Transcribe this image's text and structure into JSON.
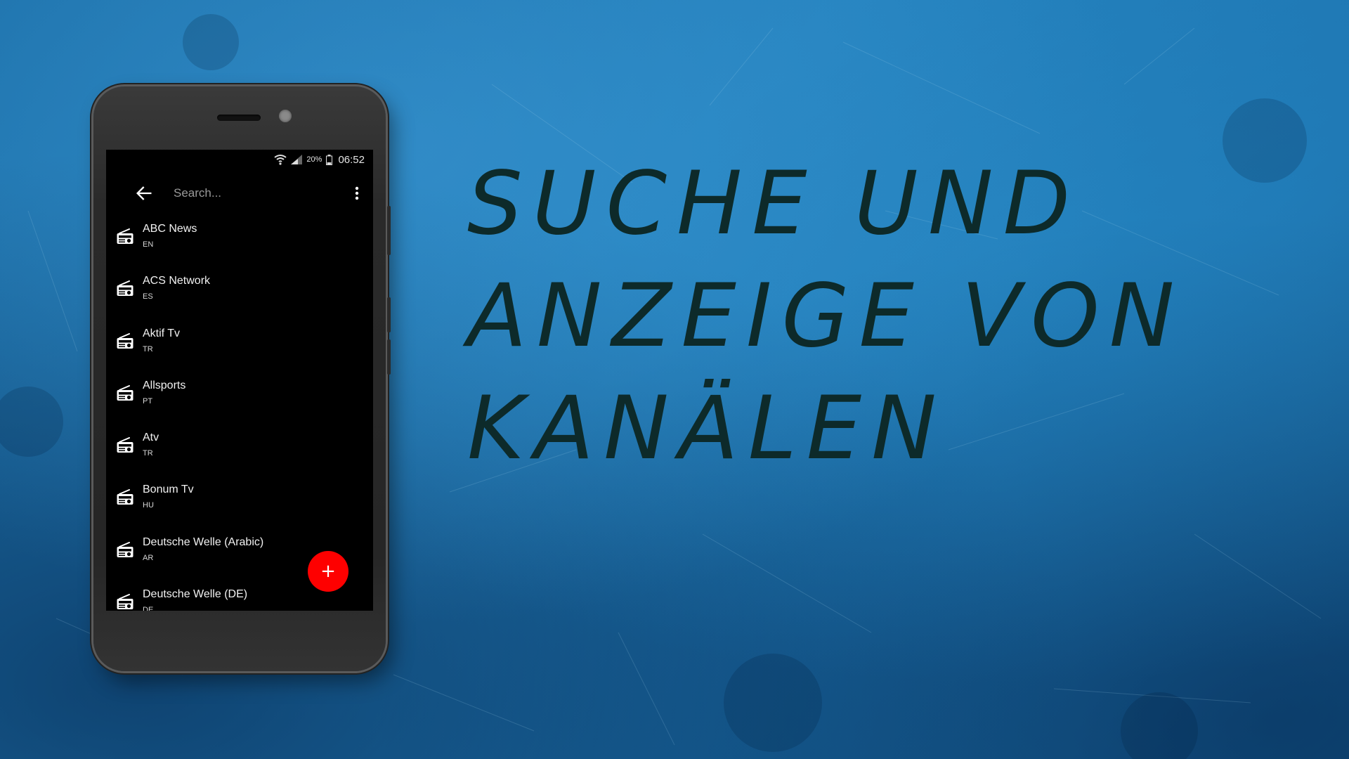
{
  "status_bar": {
    "battery_percent": "20%",
    "time": "06:52",
    "icons": [
      "wifi-icon",
      "signal-icon",
      "battery-icon"
    ]
  },
  "search": {
    "placeholder": "Search..."
  },
  "channels": [
    {
      "name": "ABC News",
      "lang": "EN"
    },
    {
      "name": "ACS Network",
      "lang": "ES"
    },
    {
      "name": "Aktif Tv",
      "lang": "TR"
    },
    {
      "name": "Allsports",
      "lang": "PT"
    },
    {
      "name": "Atv",
      "lang": "TR"
    },
    {
      "name": "Bonum Tv",
      "lang": "HU"
    },
    {
      "name": "Deutsche Welle (Arabic)",
      "lang": "AR"
    },
    {
      "name": "Deutsche Welle (DE)",
      "lang": "DE"
    }
  ],
  "fab": {
    "label": "+"
  },
  "headline": {
    "line1": "Suche und",
    "line2": "Anzeige von",
    "line3": "Kanälen"
  },
  "colors": {
    "background": "#1f78b4",
    "screen": "#000000",
    "fab": "#fe0000",
    "headline_text": "#0d2a2a"
  }
}
